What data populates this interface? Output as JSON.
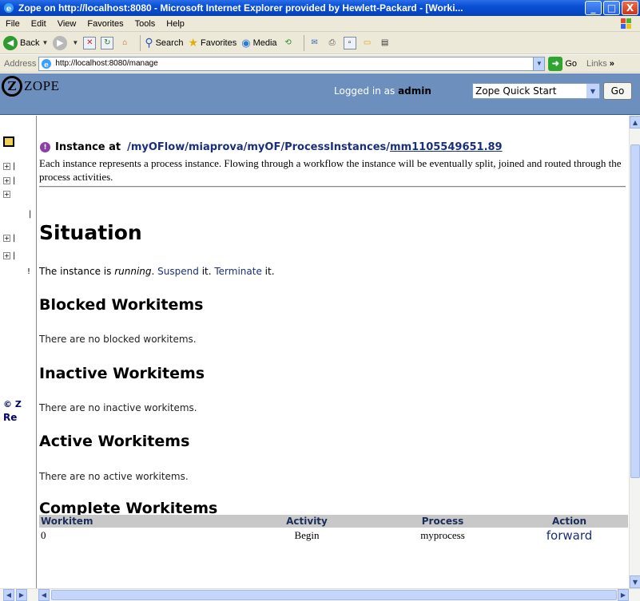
{
  "window": {
    "title": "Zope on http://localhost:8080 - Microsoft Internet Explorer provided by Hewlett-Packard - [Worki...",
    "minimize": "_",
    "maximize": "□",
    "close": "X"
  },
  "menu": [
    "File",
    "Edit",
    "View",
    "Favorites",
    "Tools",
    "Help"
  ],
  "toolbar": {
    "back": "Back",
    "search": "Search",
    "favorites": "Favorites",
    "media": "Media"
  },
  "address": {
    "label": "Address",
    "url": "http://localhost:8080/manage",
    "go": "Go",
    "links": "Links"
  },
  "zope": {
    "logo_text": "ZOPE",
    "logged_in_prefix": "Logged in as",
    "user": "admin",
    "quick_start": "Zope Quick Start",
    "go": "Go"
  },
  "tree": {
    "copyright": "© Z",
    "re": "Re"
  },
  "main": {
    "instance_label": "Instance at",
    "path": "/myOFlow/miaprova/myOF/ProcessInstances/",
    "instance_id": "mm1105549651.89",
    "description": "Each instance represents a process instance. Flowing through a workflow the instance will be eventually split, joined and routed through the process activities.",
    "situation_heading": "Situation",
    "running_prefix": "The instance is",
    "running_state": "running",
    "suspend_link": "Suspend",
    "suspend_suffix": "it.",
    "terminate_link": "Terminate",
    "terminate_suffix": "it.",
    "blocked_heading": "Blocked Workitems",
    "blocked_text": "There are no blocked workitems.",
    "inactive_heading": "Inactive Workitems",
    "inactive_text": "There are no inactive workitems.",
    "active_heading": "Active Workitems",
    "active_text": "There are no active workitems.",
    "complete_heading": "Complete Workitems",
    "table_headers": [
      "Workitem",
      "Activity",
      "Process",
      "Action"
    ],
    "table_rows": [
      {
        "workitem": "0",
        "activity": "Begin",
        "process": "myprocess",
        "action": "forward"
      }
    ]
  }
}
